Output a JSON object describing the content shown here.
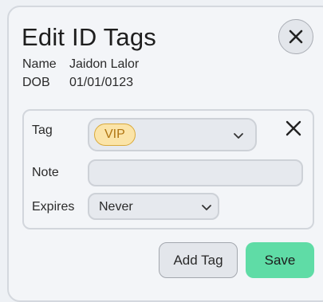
{
  "dialog": {
    "title": "Edit ID Tags",
    "close_icon": "close-icon"
  },
  "info": {
    "name_label": "Name",
    "name_value": "Jaidon Lalor",
    "dob_label": "DOB",
    "dob_value": "01/01/0123"
  },
  "tag_form": {
    "tag_label": "Tag",
    "tag_value": "VIP",
    "note_label": "Note",
    "note_value": "",
    "note_placeholder": "",
    "expires_label": "Expires",
    "expires_value": "Never"
  },
  "actions": {
    "add_tag_label": "Add Tag",
    "save_label": "Save"
  },
  "colors": {
    "save_bg": "#5fdca6",
    "chip_bg": "#fbe4a8",
    "chip_text": "#b07512"
  }
}
